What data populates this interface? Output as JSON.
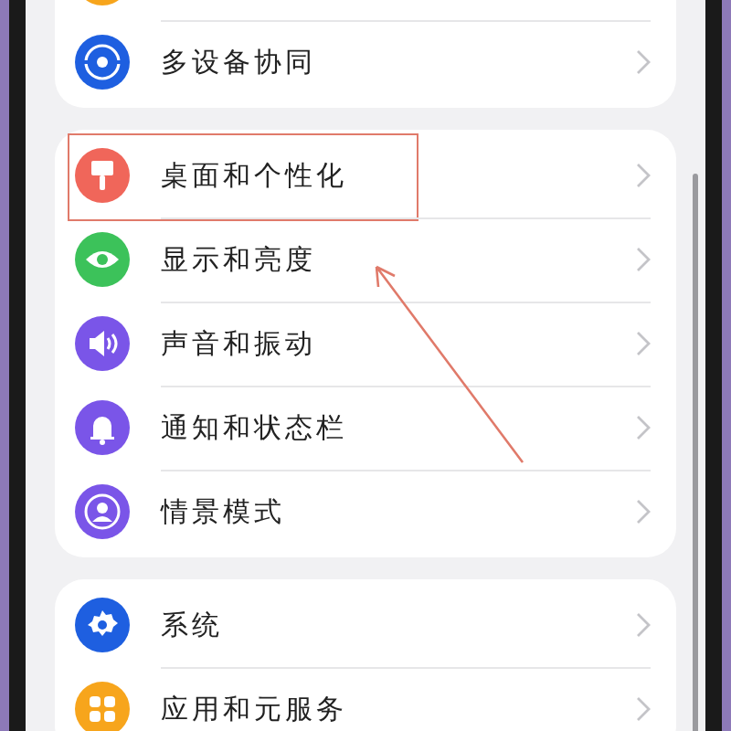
{
  "groups": [
    {
      "items": [
        {
          "kind": "partial"
        },
        {
          "kind": "collab",
          "label": "多设备协同",
          "highlighted": false
        }
      ]
    },
    {
      "items": [
        {
          "kind": "theme",
          "label": "桌面和个性化",
          "highlighted": true
        },
        {
          "kind": "display",
          "label": "显示和亮度",
          "highlighted": false
        },
        {
          "kind": "sound",
          "label": "声音和振动",
          "highlighted": false
        },
        {
          "kind": "notify",
          "label": "通知和状态栏",
          "highlighted": false
        },
        {
          "kind": "scene",
          "label": "情景模式",
          "highlighted": false
        }
      ]
    },
    {
      "items": [
        {
          "kind": "system",
          "label": "系统",
          "highlighted": false
        },
        {
          "kind": "apps",
          "label": "应用和元服务",
          "highlighted": false
        }
      ]
    }
  ]
}
